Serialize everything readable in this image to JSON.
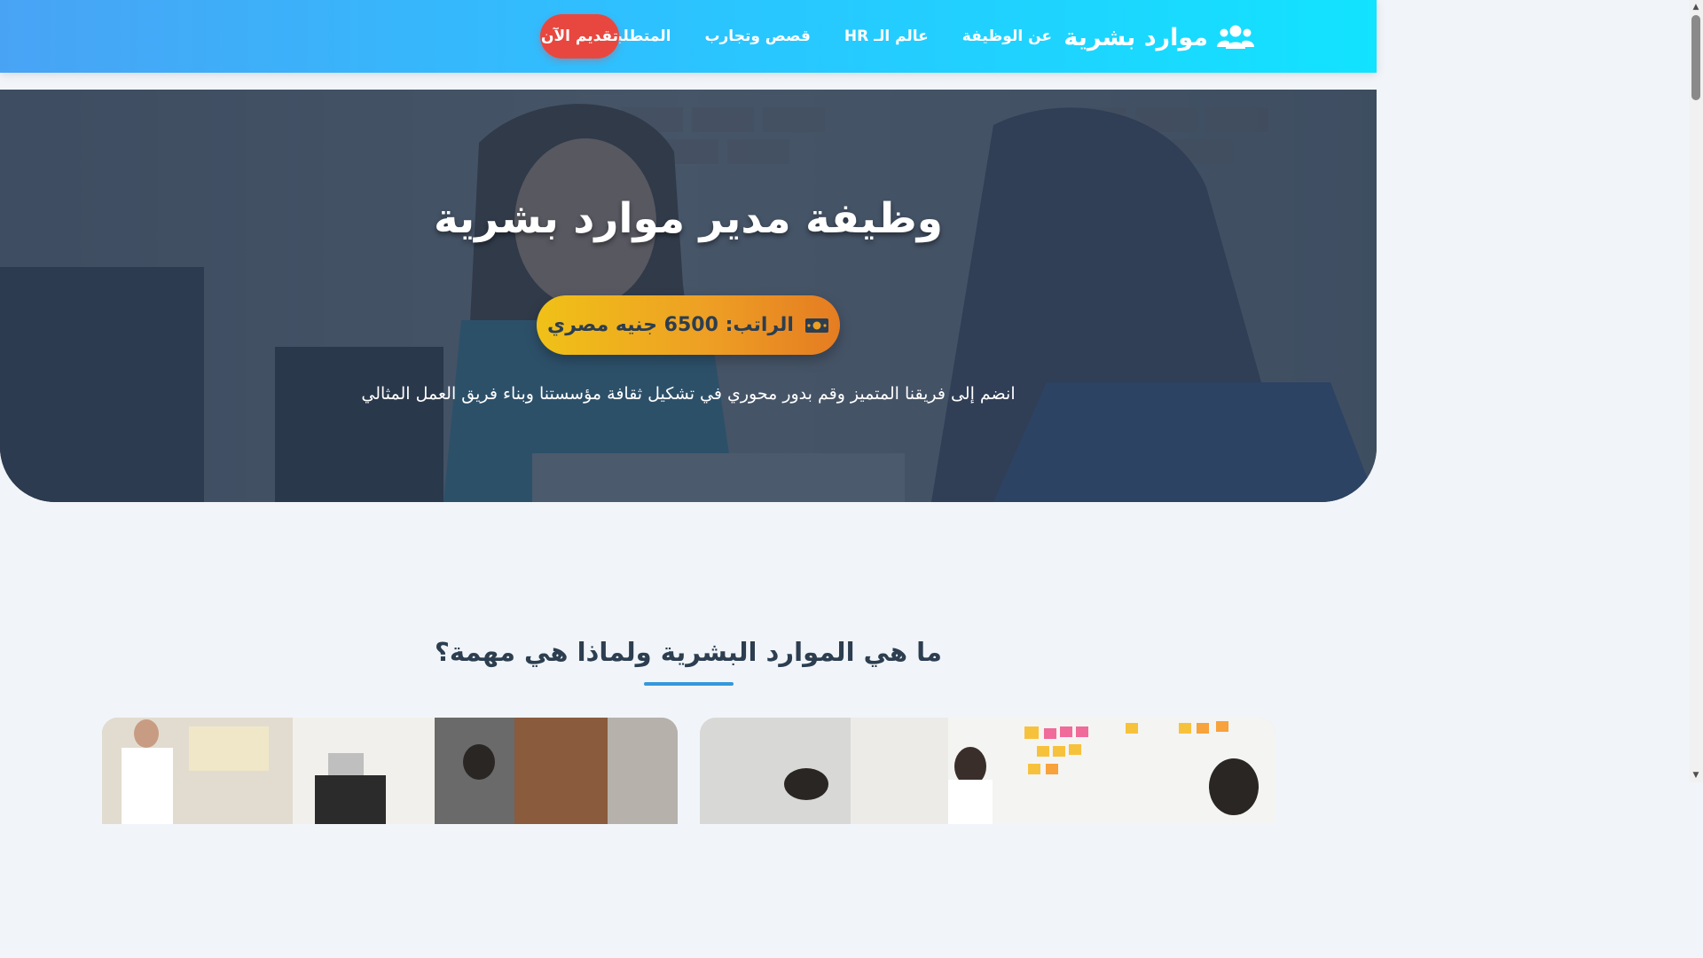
{
  "nav": {
    "brand": "موارد بشرية",
    "brand_icon": "users-icon",
    "links": [
      "عن الوظيفة",
      "عالم الـ HR",
      "قصص وتجارب",
      "المتطلبات"
    ],
    "apply_label": "تقديم الآن",
    "colors": {
      "gradient_start": "#49a3f5",
      "gradient_end": "#12e3ff",
      "apply": "#e8473f"
    }
  },
  "hero": {
    "title": "وظيفة مدير موارد بشرية",
    "salary": "الراتب: 6500 جنيه مصري",
    "salary_icon": "money-bill-icon",
    "subtitle": "انضم إلى فريقنا المتميز وقم بدور محوري في تشكيل ثقافة مؤسستنا وبناء فريق العمل المثالي"
  },
  "section": {
    "title": "ما هي الموارد البشرية ولماذا هي مهمة؟",
    "accent": "#3498db"
  },
  "scrollbar": {
    "up_icon": "scroll-up-icon",
    "down_icon": "scroll-down-icon"
  }
}
